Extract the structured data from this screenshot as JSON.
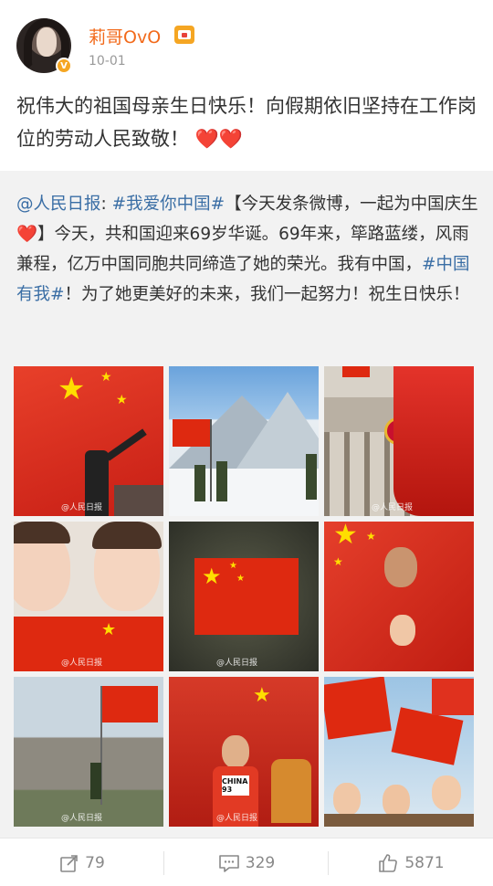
{
  "user": {
    "name": "莉哥OvO",
    "time": "10-01",
    "badge": "V"
  },
  "post": {
    "text": "祝伟大的祖国母亲生日快乐！向假期依旧坚持在工作岗位的劳动人民致敬！",
    "hearts": "❤️❤️"
  },
  "repost": {
    "mention": "@人民日报",
    "colon": ": ",
    "tag1": "#我爱你中国#",
    "bracket_text": "【今天发条微博，一起为中国庆生",
    "heart": "❤️",
    "body1": "】今天，共和国迎来69岁华诞。69年来，筚路蓝缕，风雨兼程，亿万中国同胞共同缔造了她的荣光。我有中国，",
    "tag2": "#中国有我#",
    "body2": "！为了她更美好的未来，我们一起努力！祝生日快乐！"
  },
  "images": [
    {
      "icon": "flag-raising-photo",
      "watermark": "@人民日报"
    },
    {
      "icon": "snow-mountain-soldiers-photo",
      "watermark": ""
    },
    {
      "icon": "tiananmen-flags-photo",
      "watermark": "@人民日报"
    },
    {
      "icon": "girls-with-flags-photo",
      "watermark": "@人民日报"
    },
    {
      "icon": "aerial-flag-photo",
      "watermark": "@人民日报"
    },
    {
      "icon": "man-and-child-flag-photo",
      "watermark": ""
    },
    {
      "icon": "coast-flag-photo",
      "watermark": "@人民日报"
    },
    {
      "icon": "athlete-flag-photo",
      "watermark": "@人民日报",
      "bib": "CHINA 93"
    },
    {
      "icon": "children-waving-flags-photo",
      "watermark": ""
    }
  ],
  "actions": {
    "repost_count": "79",
    "comment_count": "329",
    "like_count": "5871"
  },
  "colors": {
    "username": "#f26a1b",
    "link": "#3a6ea5",
    "flag_red": "#de2910",
    "flag_yellow": "#ffde00"
  }
}
